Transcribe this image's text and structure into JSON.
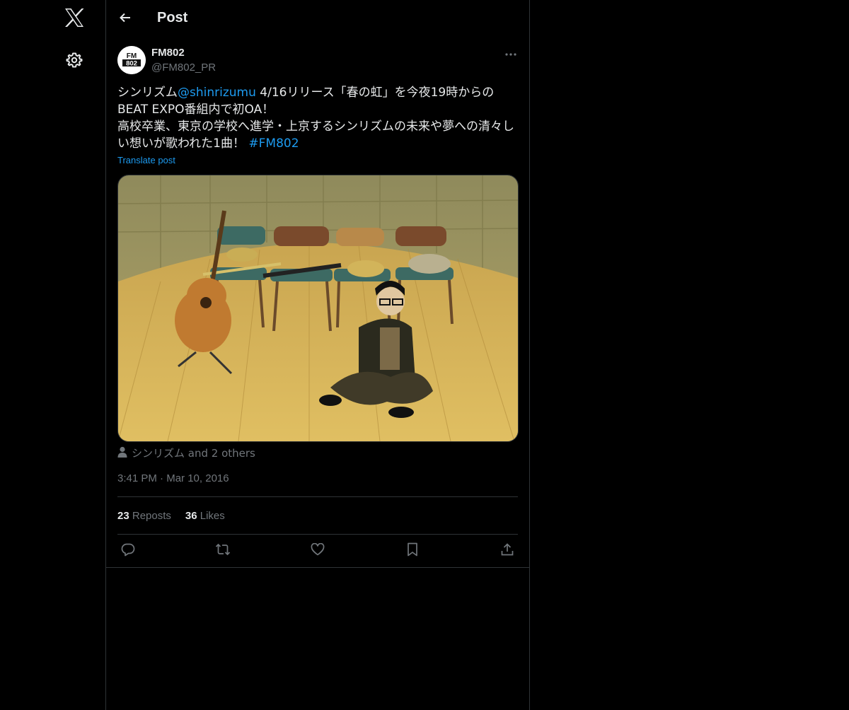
{
  "nav": {
    "logo_icon": "x-logo-icon",
    "settings_icon": "gear-icon"
  },
  "header": {
    "back_icon": "arrow-left-icon",
    "title": "Post"
  },
  "post": {
    "author_name": "FM802",
    "author_handle": "@FM802_PR",
    "avatar_text": "FM 802",
    "text": {
      "part1": "シンリズム",
      "mention": "@shinrizumu",
      "part2": " 4/16リリース「春の虹」を今夜19時からのBEAT EXPO番組内で初OA！",
      "part3": "高校卒業、東京の学校へ進学・上京するシンリズムの未来や夢への清々しい想いが歌われた1曲！",
      "hashtag": "#FM802"
    },
    "translate_label": "Translate post",
    "tagged": "シンリズム and 2 others",
    "time": "3:41 PM",
    "date_sep": "·",
    "date": "Mar 10, 2016",
    "reposts_count": "23",
    "reposts_label": "Reposts",
    "likes_count": "36",
    "likes_label": "Likes"
  },
  "actions": [
    "reply-icon",
    "repost-icon",
    "like-icon",
    "bookmark-icon",
    "share-icon"
  ],
  "colors": {
    "background": "#000000",
    "text": "#e7e9ea",
    "muted": "#71767b",
    "accent": "#1d9bf0",
    "border": "#2f3336"
  }
}
